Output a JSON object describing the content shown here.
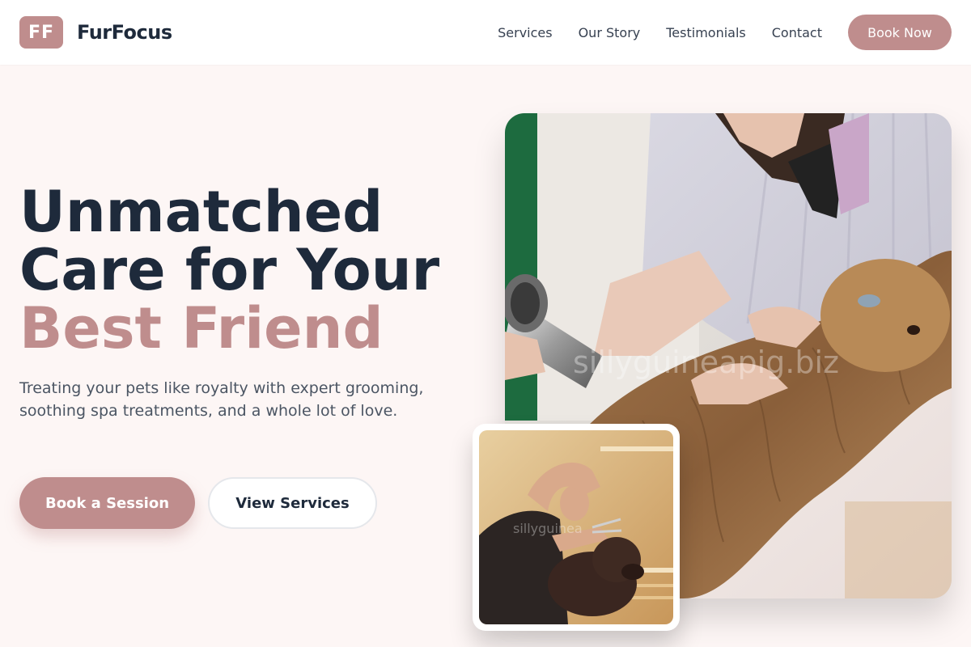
{
  "brand": {
    "logo_text": "FF",
    "name": "FurFocus",
    "accent_color": "#bf8d8d",
    "dark_color": "#1e2a3b"
  },
  "nav": {
    "links": [
      {
        "label": "Services"
      },
      {
        "label": "Our Story"
      },
      {
        "label": "Testimonials"
      },
      {
        "label": "Contact"
      }
    ],
    "cta_label": "Book Now"
  },
  "hero": {
    "title_line1": "Unmatched",
    "title_line2": "Care for Your",
    "title_line3": "Best Friend",
    "subtitle": "Treating your pets like royalty with expert grooming, soothing spa treatments, and a whole lot of love.",
    "primary_button": "Book a Session",
    "secondary_button": "View Services"
  },
  "images": {
    "main_photo": {
      "watermark": "sillyguineapig.biz"
    },
    "inset_photo": {
      "watermark": "sillyguinea"
    }
  }
}
